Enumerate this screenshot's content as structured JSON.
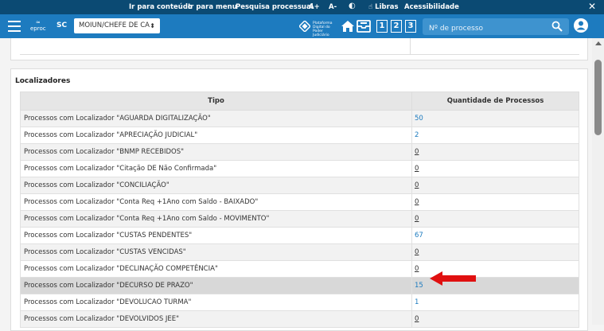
{
  "access_bar": {
    "items": [
      "Ir para conteúdo",
      "Ir para menu",
      "Pesquisa processual",
      "A+",
      "A-",
      "◐",
      "Libras",
      "Acessibilidade"
    ],
    "close": "✕"
  },
  "header": {
    "logo_text": "eproc",
    "state": "SC",
    "profile_select": "MOIUN/CHEFE DE CA",
    "pdpj_text": "Plataforma Digital do Poder Judiciário",
    "shortcut_numbers": [
      "1",
      "2",
      "3"
    ],
    "search_placeholder": "Nº de processo"
  },
  "localizadores": {
    "title": "Localizadores",
    "columns": [
      "Tipo",
      "Quantidade de Processos"
    ],
    "rows": [
      {
        "tipo": "Processos com Localizador  \"AGUARDA DIGITALIZAÇÃO\"",
        "qtd": "50"
      },
      {
        "tipo": "Processos com Localizador  \"APRECIAÇÃO JUDICIAL\"",
        "qtd": "2"
      },
      {
        "tipo": "Processos com Localizador  \"BNMP RECEBIDOS\"",
        "qtd": "0"
      },
      {
        "tipo": "Processos com Localizador  \"Citação DE Não Confirmada\"",
        "qtd": "0"
      },
      {
        "tipo": "Processos com Localizador  \"CONCILIAÇÃO\"",
        "qtd": "0"
      },
      {
        "tipo": "Processos com Localizador  \"Conta Req +1Ano com Saldo - BAIXADO\"",
        "qtd": "0"
      },
      {
        "tipo": "Processos com Localizador  \"Conta Req +1Ano com Saldo - MOVIMENTO\"",
        "qtd": "0"
      },
      {
        "tipo": "Processos com Localizador  \"CUSTAS PENDENTES\"",
        "qtd": "67"
      },
      {
        "tipo": "Processos com Localizador  \"CUSTAS VENCIDAS\"",
        "qtd": "0"
      },
      {
        "tipo": "Processos com Localizador  \"DECLINAÇÃO COMPETÊNCIA\"",
        "qtd": "0"
      },
      {
        "tipo": "Processos com Localizador  \"DECURSO DE PRAZO\"",
        "qtd": "15"
      },
      {
        "tipo": "Processos com Localizador  \"DEVOLUCAO TURMA\"",
        "qtd": "1"
      },
      {
        "tipo": "Processos com Localizador  \"DEVOLVIDOS JEE\"",
        "qtd": "0"
      }
    ],
    "highlighted_row": "DECURSO DE PRAZO"
  },
  "colors": {
    "header": "#1d7bbf",
    "access_bar": "#0b4a73",
    "link": "#1d7bbf",
    "arrow": "#e01010"
  }
}
